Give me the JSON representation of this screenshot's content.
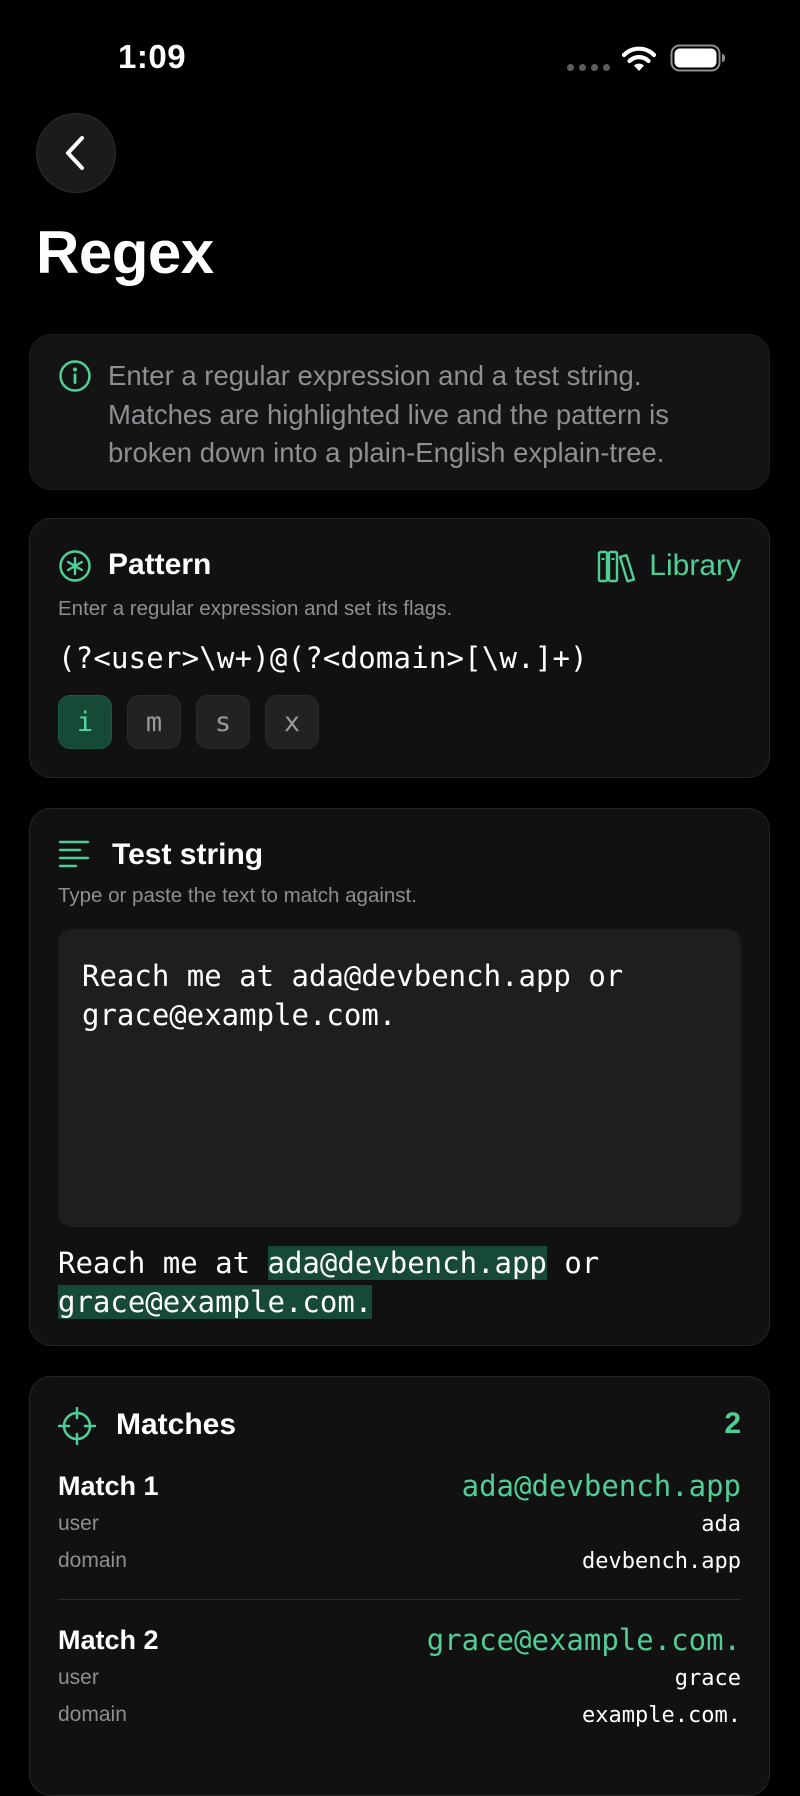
{
  "status": {
    "time": "1:09"
  },
  "nav": {
    "title": "Regex"
  },
  "info": {
    "text": "Enter a regular expression and a test string. Matches are highlighted live and the pattern is broken down into a plain-English explain-tree."
  },
  "pattern": {
    "title": "Pattern",
    "subtitle": "Enter a regular expression and set its flags.",
    "library_label": "Library",
    "value": "(?<user>\\w+)@(?<domain>[\\w.]+)",
    "flags": [
      {
        "label": "i",
        "active": true
      },
      {
        "label": "m",
        "active": false
      },
      {
        "label": "s",
        "active": false
      },
      {
        "label": "x",
        "active": false
      }
    ]
  },
  "test": {
    "title": "Test string",
    "subtitle": "Type or paste the text to match against.",
    "input_value": "Reach me at ada@devbench.app or\ngrace@example.com.",
    "highlight": {
      "line1_prefix": "Reach me at ",
      "line1_match": "ada@devbench.app",
      "line1_suffix": " or",
      "line2_match": "grace@example.com."
    }
  },
  "matches": {
    "title": "Matches",
    "count": "2",
    "items": [
      {
        "label": "Match 1",
        "value": "ada@devbench.app",
        "groups": [
          {
            "name": "user",
            "value": "ada"
          },
          {
            "name": "domain",
            "value": "devbench.app"
          }
        ]
      },
      {
        "label": "Match 2",
        "value": "grace@example.com.",
        "groups": [
          {
            "name": "user",
            "value": "grace"
          },
          {
            "name": "domain",
            "value": "example.com."
          }
        ]
      }
    ]
  },
  "colors": {
    "accent": "#4fcf95",
    "highlight_bg": "#174a36",
    "background": "#000000",
    "card": "#111112"
  }
}
